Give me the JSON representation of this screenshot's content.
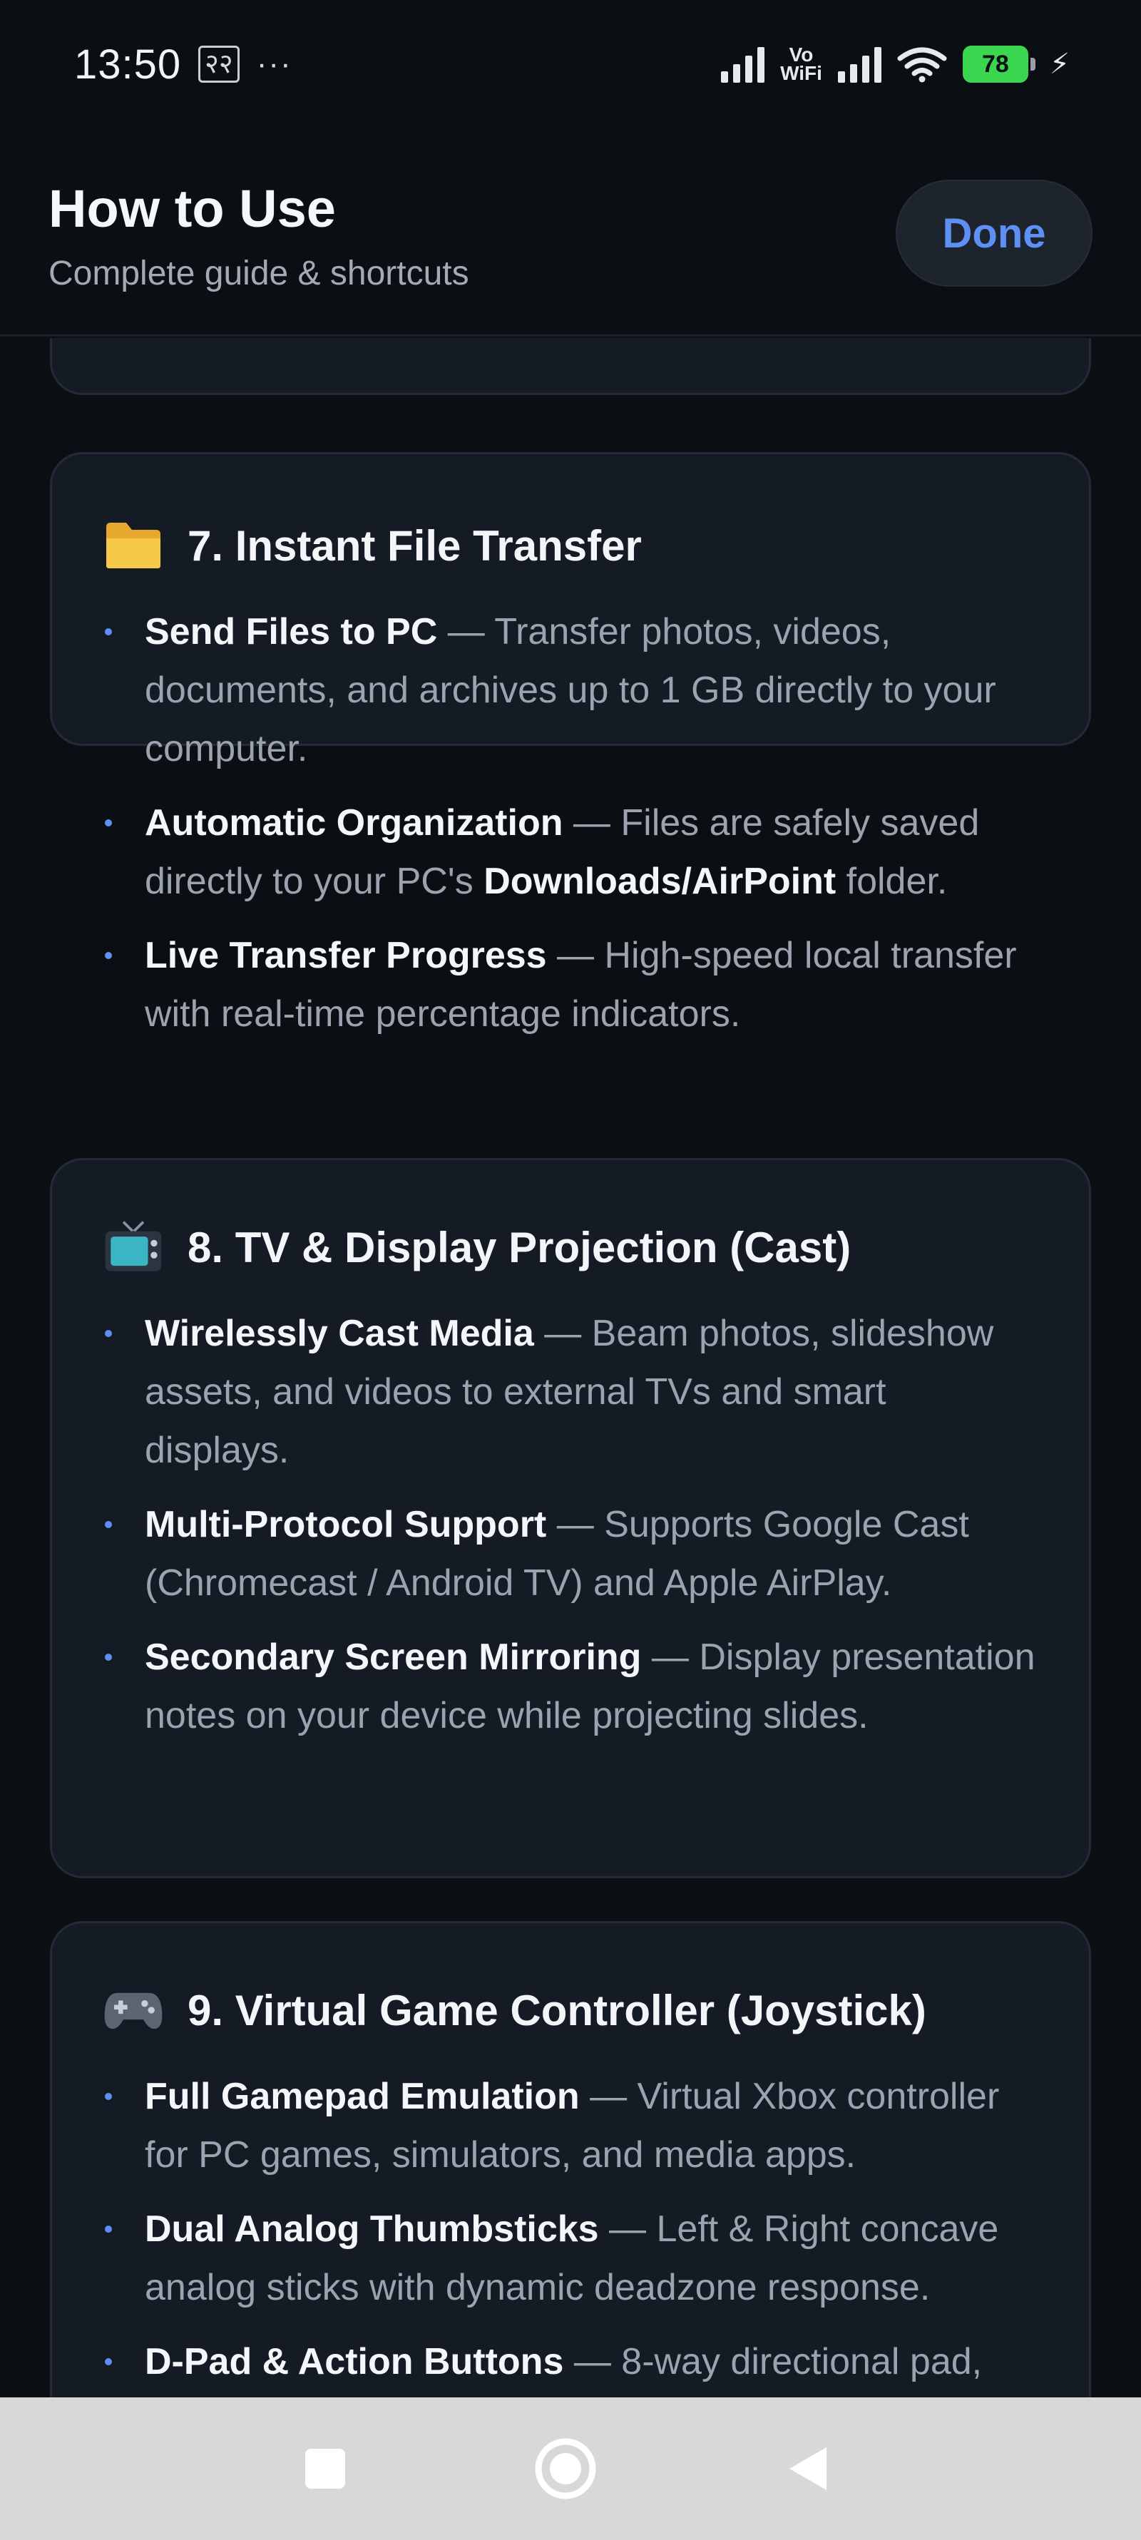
{
  "status": {
    "time": "13:50",
    "glyph": "२२",
    "dots": "···",
    "volte_top": "Vo",
    "volte_bottom": "WiFi",
    "battery": "78"
  },
  "header": {
    "title": "How to Use",
    "subtitle": "Complete guide & shortcuts",
    "done_label": "Done"
  },
  "cards": [
    {
      "icon": "folder-icon",
      "title": "7. Instant File Transfer",
      "bullets": [
        {
          "strong": "Send Files to PC",
          "text": " — Transfer photos, videos, documents, and archives up to 1 GB directly to your computer."
        },
        {
          "strong": "Automatic Organization",
          "text": " — Files are safely saved directly to your PC's ",
          "strong2": "Downloads/AirPoint",
          "text2": " folder."
        },
        {
          "strong": "Live Transfer Progress",
          "text": " — High-speed local transfer with real-time percentage indicators."
        }
      ]
    },
    {
      "icon": "tv-icon",
      "title": "8. TV & Display Projection (Cast)",
      "bullets": [
        {
          "strong": "Wirelessly Cast Media",
          "text": " — Beam photos, slideshow assets, and videos to external TVs and smart displays."
        },
        {
          "strong": "Multi-Protocol Support",
          "text": " — Supports Google Cast (Chromecast / Android TV) and Apple AirPlay."
        },
        {
          "strong": "Secondary Screen Mirroring",
          "text": " — Display presentation notes on your device while projecting slides."
        }
      ]
    },
    {
      "icon": "gamepad-icon",
      "title": "9. Virtual Game Controller (Joystick)",
      "bullets": [
        {
          "strong": "Full Gamepad Emulation",
          "text": " — Virtual Xbox controller for PC games, simulators, and media apps."
        },
        {
          "strong": "Dual Analog Thumbsticks",
          "text": " — Left & Right concave analog sticks with dynamic deadzone response."
        },
        {
          "strong": "D-Pad & Action Buttons",
          "text": " — 8-way directional pad,"
        }
      ]
    }
  ],
  "colors": {
    "background": "#0b0e13",
    "card": "#151b24",
    "accent": "#5d90f2",
    "battery": "#3bd64f"
  }
}
